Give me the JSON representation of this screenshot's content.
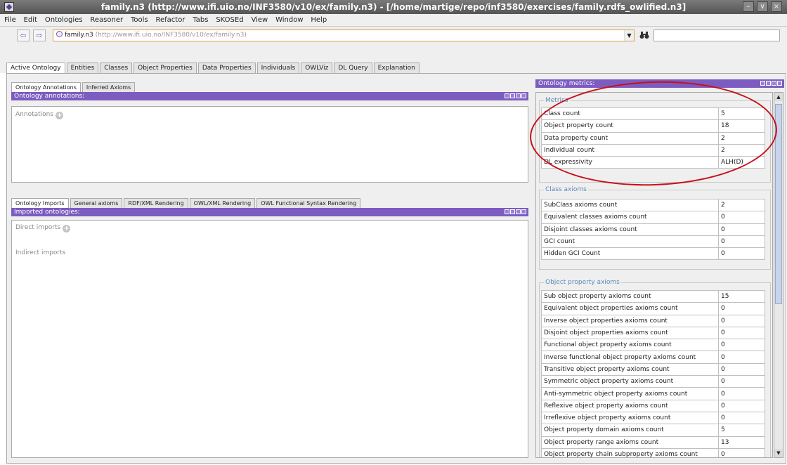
{
  "window": {
    "title": "family.n3 (http://www.ifi.uio.no/INF3580/v10/ex/family.n3) - [/home/martige/repo/inf3580/exercises/family.rdfs_owlified.n3]",
    "minimize": "–",
    "maximize": "∨",
    "close": "×"
  },
  "menu": [
    "File",
    "Edit",
    "Ontologies",
    "Reasoner",
    "Tools",
    "Refactor",
    "Tabs",
    "SKOSEd",
    "View",
    "Window",
    "Help"
  ],
  "nav": {
    "back": "⇦",
    "forward": "⇨",
    "ontology_name": "family.n3",
    "ontology_url": "(http://www.ifi.uio.no/INF3580/v10/ex/family.n3)",
    "dropdown_arrow": "▼",
    "search_icon": "binoculars-icon",
    "search_value": ""
  },
  "main_tabs": [
    "Active Ontology",
    "Entities",
    "Classes",
    "Object Properties",
    "Data Properties",
    "Individuals",
    "OWLViz",
    "DL Query",
    "Explanation"
  ],
  "annotations_panel": {
    "tabs": [
      "Ontology Annotations",
      "Inferred Axioms"
    ],
    "header": "Ontology annotations:",
    "label": "Annotations"
  },
  "imports_panel": {
    "tabs": [
      "Ontology Imports",
      "General axioms",
      "RDF/XML Rendering",
      "OWL/XML Rendering",
      "OWL Functional Syntax Rendering"
    ],
    "header": "Imported ontologies:",
    "direct": "Direct imports",
    "indirect": "Indirect imports"
  },
  "metrics_panel": {
    "header": "Ontology metrics:",
    "groups": [
      {
        "label": "Metrics",
        "rows": [
          {
            "name": "Class count",
            "value": "5"
          },
          {
            "name": "Object property count",
            "value": "18"
          },
          {
            "name": "Data property count",
            "value": "2"
          },
          {
            "name": "Individual count",
            "value": "2"
          },
          {
            "name": "DL expressivity",
            "value": "ALH(D)"
          }
        ]
      },
      {
        "label": "Class axioms",
        "rows": [
          {
            "name": "SubClass axioms count",
            "value": "2"
          },
          {
            "name": "Equivalent classes axioms count",
            "value": "0"
          },
          {
            "name": "Disjoint classes axioms count",
            "value": "0"
          },
          {
            "name": "GCI count",
            "value": "0"
          },
          {
            "name": "Hidden GCI Count",
            "value": "0"
          }
        ]
      },
      {
        "label": "Object property axioms",
        "rows": [
          {
            "name": "Sub object property axioms count",
            "value": "15"
          },
          {
            "name": "Equivalent object properties axioms count",
            "value": "0"
          },
          {
            "name": "Inverse object properties axioms count",
            "value": "0"
          },
          {
            "name": "Disjoint object properties axioms count",
            "value": "0"
          },
          {
            "name": "Functional object property axioms count",
            "value": "0"
          },
          {
            "name": "Inverse functional object property axioms count",
            "value": "0"
          },
          {
            "name": "Transitive object property axioms count",
            "value": "0"
          },
          {
            "name": "Symmetric object property axioms count",
            "value": "0"
          },
          {
            "name": "Anti-symmetric object property axioms count",
            "value": "0"
          },
          {
            "name": "Reflexive object property axioms count",
            "value": "0"
          },
          {
            "name": "Irreflexive object property axioms count",
            "value": "0"
          },
          {
            "name": "Object property domain axioms count",
            "value": "5"
          },
          {
            "name": "Object property range axioms count",
            "value": "13"
          },
          {
            "name": "Object property chain subproperty axioms count",
            "value": "0"
          }
        ]
      }
    ],
    "scroll_up": "▲",
    "scroll_down": "▼"
  },
  "colors": {
    "view_header": "#7c5cc0",
    "annotation_circle": "#c8101a",
    "group_label": "#5a8ab8"
  }
}
